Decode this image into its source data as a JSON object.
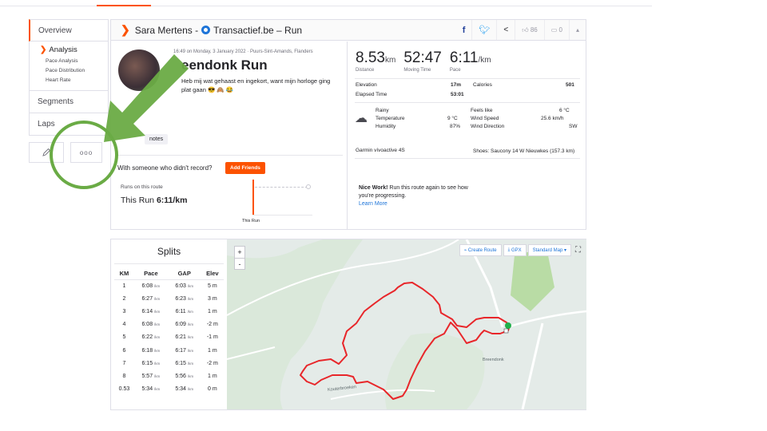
{
  "sidebar": {
    "overview": "Overview",
    "analysis": "Analysis",
    "sub_items": [
      "Pace Analysis",
      "Pace Distribution",
      "Heart Rate"
    ],
    "segments": "Segments",
    "laps": "Laps",
    "more": "ooo"
  },
  "header": {
    "title_pre": "Sara Mertens - ",
    "title_post": "Transactief.be – Run",
    "kudos": "86",
    "comments": "0"
  },
  "activity": {
    "date_loc": "16:49 on Monday, 3 January 2022 · Puurs-Sint-Amands, Flanders",
    "title": "eendonk Run",
    "description": "Heb mij wat gehaast en ingekort, want mijn horloge ging plat gaan 😎 🙈 😂",
    "notes": "notes",
    "with_someone": "With someone who didn't record?",
    "add_friends": "Add Friends"
  },
  "stats": {
    "distance": "8.53",
    "distance_unit": "km",
    "distance_label": "Distance",
    "moving_time": "52:47",
    "moving_time_label": "Moving Time",
    "pace": "6:11",
    "pace_unit": "/km",
    "pace_label": "Pace",
    "elevation_label": "Elevation",
    "elevation": "17m",
    "calories_label": "Calories",
    "calories": "501",
    "elapsed_label": "Elapsed Time",
    "elapsed": "53:01"
  },
  "weather": {
    "condition": "Rainy",
    "temp_label": "Temperature",
    "temp": "9 °C",
    "humidity_label": "Humidity",
    "humidity": "87%",
    "feels_label": "Feels like",
    "feels": "6 °C",
    "wind_speed_label": "Wind Speed",
    "wind_speed": "25.6 km/h",
    "wind_dir_label": "Wind Direction",
    "wind_dir": "SW"
  },
  "gear": {
    "device": "Garmin vívoactive 4S",
    "shoes": "Shoes: Saucony 14 W Nieuwkes (157.3 km)"
  },
  "route": {
    "runs_label": "Runs on this route",
    "this_run_pre": "This Run ",
    "this_run_pace": "6:11/km",
    "graph_label": "This Run",
    "nice_bold": "Nice Work!",
    "nice_text": " Run this route again to see how you're progressing.",
    "learn_more": "Learn More"
  },
  "splits": {
    "title": "Splits",
    "columns": [
      "KM",
      "Pace",
      "GAP",
      "Elev"
    ],
    "rows": [
      {
        "km": "1",
        "pace": "6:08",
        "gap": "6:03",
        "elev": "5 m"
      },
      {
        "km": "2",
        "pace": "6:27",
        "gap": "6:23",
        "elev": "3 m"
      },
      {
        "km": "3",
        "pace": "6:14",
        "gap": "6:11",
        "elev": "1 m"
      },
      {
        "km": "4",
        "pace": "6:08",
        "gap": "6:09",
        "elev": "-2 m"
      },
      {
        "km": "5",
        "pace": "6:22",
        "gap": "6:21",
        "elev": "-1 m"
      },
      {
        "km": "6",
        "pace": "6:18",
        "gap": "6:17",
        "elev": "1 m"
      },
      {
        "km": "7",
        "pace": "6:15",
        "gap": "6:15",
        "elev": "-2 m"
      },
      {
        "km": "8",
        "pace": "5:57",
        "gap": "5:56",
        "elev": "1 m"
      },
      {
        "km": "0.53",
        "pace": "5:34",
        "gap": "5:34",
        "elev": "0 m"
      }
    ],
    "unit": "/km"
  },
  "map": {
    "zoom_in": "+",
    "zoom_out": "-",
    "create_route": "Create Route",
    "gpx": "GPX",
    "map_type": "Standard Map",
    "town": "Breendonk",
    "road1": "Kouterbroeken",
    "route_color": "#e8262a"
  },
  "colors": {
    "accent": "#fc5200",
    "annotation": "#6aab45"
  }
}
